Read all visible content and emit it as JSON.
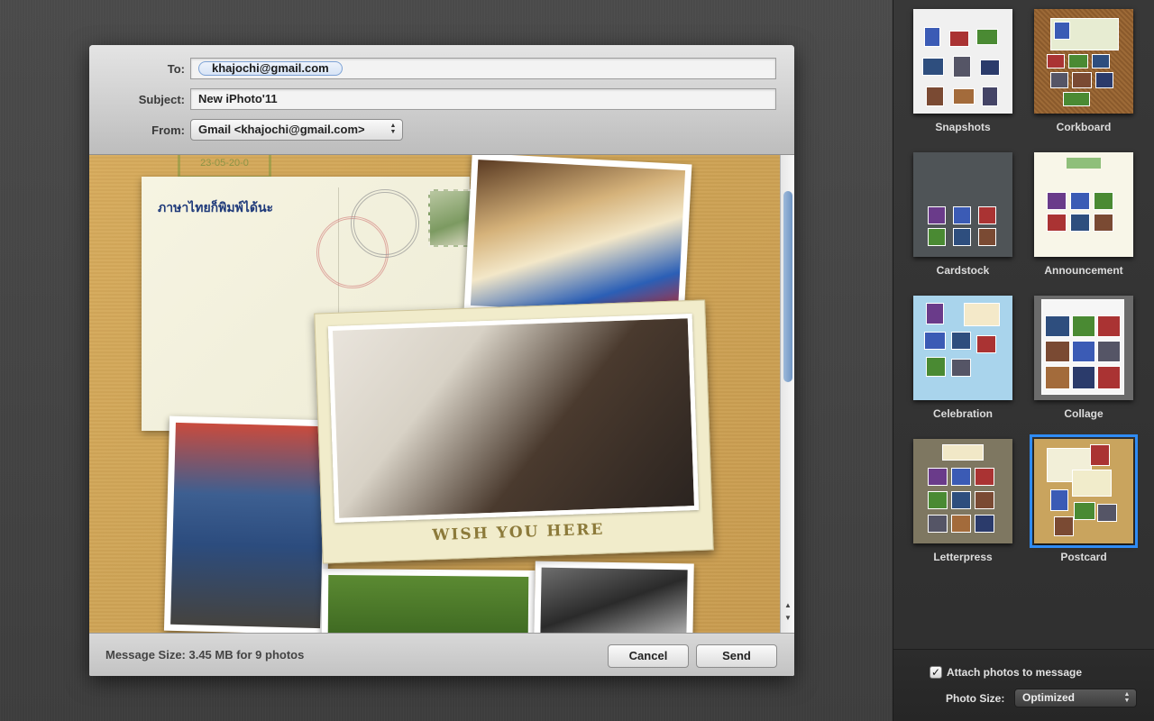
{
  "compose": {
    "to_label": "To:",
    "to_value": "khajochi@gmail.com",
    "subject_label": "Subject:",
    "subject_value": "New iPhoto'11",
    "from_label": "From:",
    "from_value": "Gmail <khajochi@gmail.com>",
    "postcard_text": "ภาษาไทยก็พิมพ์ได้นะ",
    "stamp_text": "23-05-20-0",
    "frame_caption": "WISH YOU HERE",
    "message_size": "Message Size: 3.45 MB for 9 photos",
    "cancel_label": "Cancel",
    "send_label": "Send"
  },
  "themes": [
    {
      "name": "Snapshots",
      "selected": false
    },
    {
      "name": "Corkboard",
      "selected": false
    },
    {
      "name": "Cardstock",
      "selected": false
    },
    {
      "name": "Announcement",
      "selected": false
    },
    {
      "name": "Celebration",
      "selected": false
    },
    {
      "name": "Collage",
      "selected": false
    },
    {
      "name": "Letterpress",
      "selected": false
    },
    {
      "name": "Postcard",
      "selected": true
    }
  ],
  "options": {
    "attach_label": "Attach photos to message",
    "attach_checked": true,
    "photo_size_label": "Photo Size:",
    "photo_size_value": "Optimized"
  },
  "colors": {
    "selection": "#2f8cf5",
    "token_border": "#7ea3d6",
    "card_background": "#d7ab5c"
  }
}
